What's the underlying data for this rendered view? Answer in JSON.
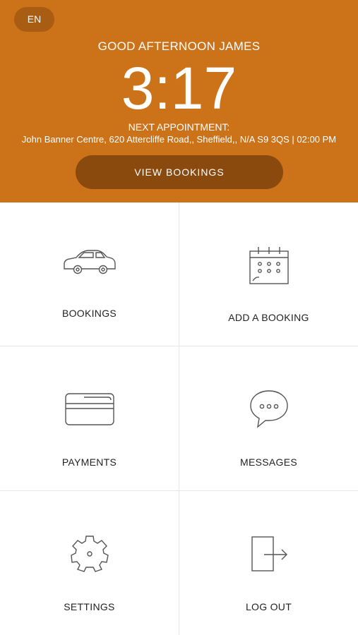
{
  "header": {
    "language": "EN",
    "greeting": "GOOD AFTERNOON JAMES",
    "time": "3:17",
    "next_appointment_label": "NEXT APPOINTMENT:",
    "next_appointment_value": "John Banner Centre, 620 Attercliffe Road,, Sheffield,, N/A S9 3QS | 02:00 PM",
    "view_bookings_label": "VIEW BOOKINGS"
  },
  "menu": {
    "bookings": {
      "label": "BOOKINGS",
      "icon": "car-icon"
    },
    "add_booking": {
      "label": "ADD A BOOKING",
      "icon": "calendar-icon"
    },
    "payments": {
      "label": "PAYMENTS",
      "icon": "credit-card-icon"
    },
    "messages": {
      "label": "MESSAGES",
      "icon": "chat-bubble-icon"
    },
    "settings": {
      "label": "SETTINGS",
      "icon": "gear-icon"
    },
    "logout": {
      "label": "LOG OUT",
      "icon": "logout-icon"
    }
  },
  "colors": {
    "header_background": "#CC7319",
    "button_background": "#8A4A0E",
    "language_button_background": "#A85D12"
  }
}
